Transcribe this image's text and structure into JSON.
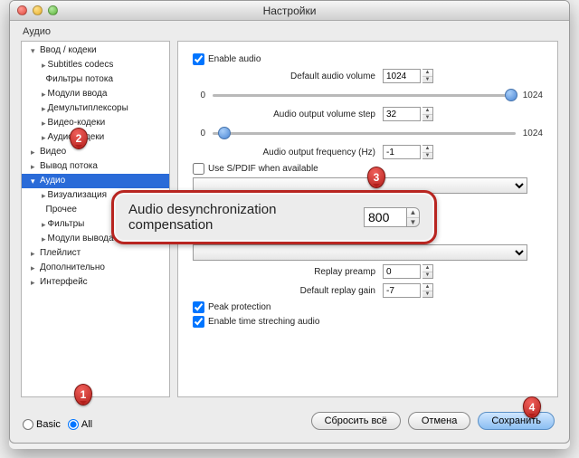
{
  "window": {
    "title": "Настройки"
  },
  "section": "Аудио",
  "tree": {
    "n0": "Ввод / кодеки",
    "n1": "Subtitles codecs",
    "n2": "Фильтры потока",
    "n3": "Модули ввода",
    "n4": "Демультиплексоры",
    "n5": "Видео-кодеки",
    "n6": "Аудио-кодеки",
    "n7": "Видео",
    "n8": "Вывод потока",
    "n9": "Аудио",
    "n10": "Визуализация",
    "n11": "Прочее",
    "n12": "Фильтры",
    "n13": "Модули вывода",
    "n14": "Плейлист",
    "n15": "Дополнительно",
    "n16": "Интерфейс"
  },
  "mode": {
    "basic": "Basic",
    "all": "All"
  },
  "main": {
    "enable_audio": "Enable audio",
    "default_volume_label": "Default audio volume",
    "default_volume_value": "1024",
    "slider1_min": "0",
    "slider1_max": "1024",
    "volume_step_label": "Audio output volume step",
    "volume_step_value": "32",
    "slider2_min": "0",
    "slider2_max": "1024",
    "freq_label": "Audio output frequency (Hz)",
    "freq_value": "-1",
    "spdif": "Use S/PDIF when available",
    "replay_preamp_label": "Replay preamp",
    "replay_preamp_value": "0",
    "default_gain_label": "Default replay gain",
    "default_gain_value": "-7",
    "peak": "Peak protection",
    "timestretch": "Enable time streching audio"
  },
  "highlight": {
    "label": "Audio desynchronization compensation",
    "value": "800"
  },
  "buttons": {
    "reset": "Сбросить всё",
    "cancel": "Отмена",
    "save": "Сохранить"
  },
  "callouts": {
    "c1": "1",
    "c2": "2",
    "c3": "3",
    "c4": "4"
  }
}
